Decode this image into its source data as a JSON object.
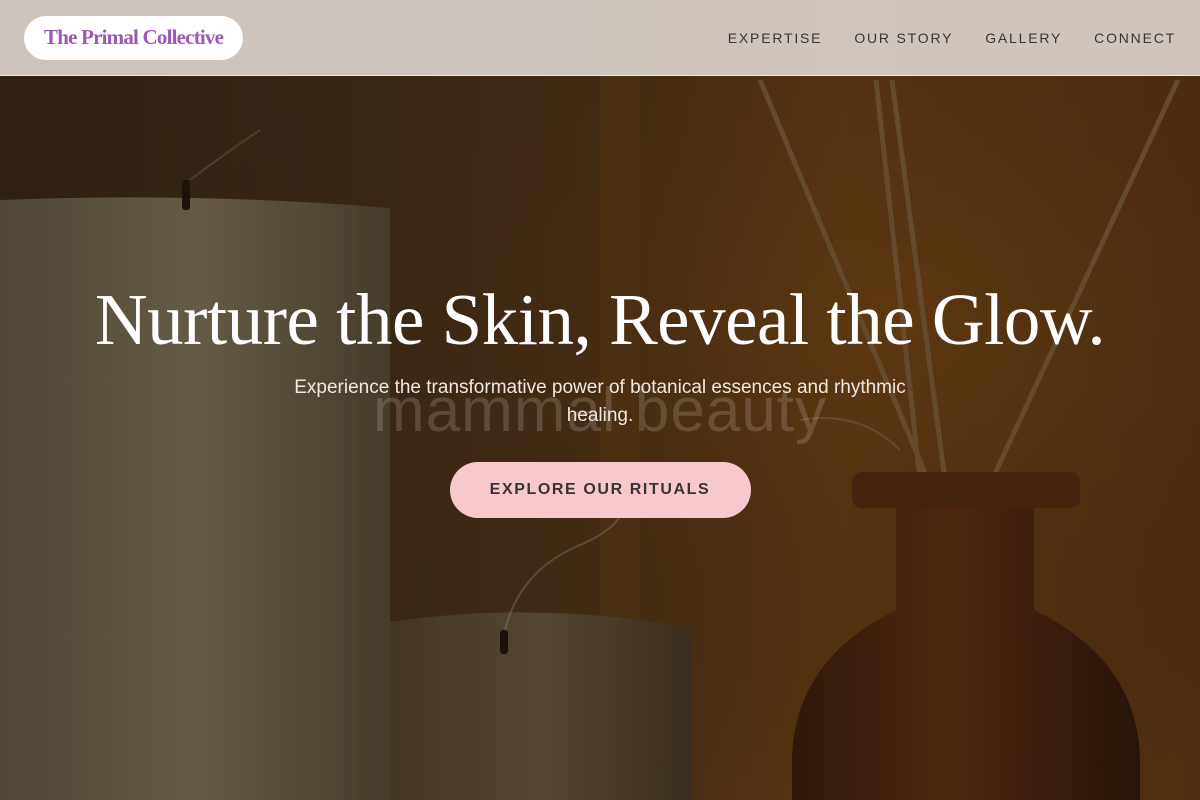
{
  "brand": {
    "name": "The Primal Collective",
    "color": "#9b59b6"
  },
  "nav": {
    "items": [
      {
        "label": "EXPERTISE"
      },
      {
        "label": "OUR STORY"
      },
      {
        "label": "GALLERY"
      },
      {
        "label": "CONNECT"
      }
    ]
  },
  "hero": {
    "title": "Nurture the Skin, Reveal the Glow.",
    "subtitle": "Experience the transformative power of botanical essences and rhythmic healing.",
    "watermark": "mammal beauty",
    "cta_label": "EXPLORE OUR RITUALS",
    "cta_color": "#f6c9cc",
    "background_image": "candles-and-reed-diffuser"
  }
}
